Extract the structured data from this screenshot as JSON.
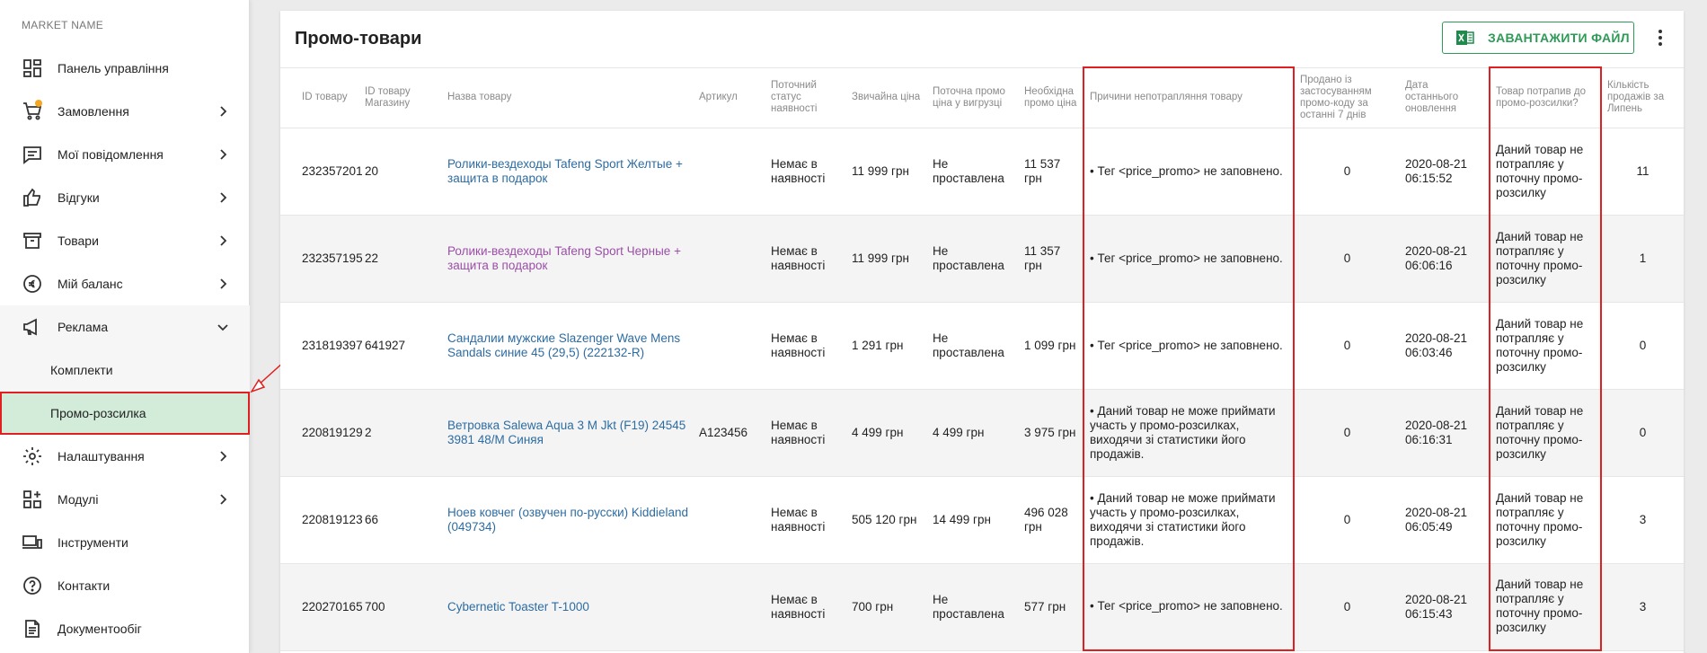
{
  "sidebar": {
    "market_name": "MARKET NAME",
    "items": [
      {
        "label": "Панель управління",
        "icon": "dashboard-icon",
        "has_children": false
      },
      {
        "label": "Замовлення",
        "icon": "cart-icon",
        "has_children": true,
        "badge": true
      },
      {
        "label": "Мої повідомлення",
        "icon": "message-icon",
        "has_children": true
      },
      {
        "label": "Відгуки",
        "icon": "thumb-up-icon",
        "has_children": true
      },
      {
        "label": "Товари",
        "icon": "box-icon",
        "has_children": true
      },
      {
        "label": "Мій баланс",
        "icon": "balance-icon",
        "has_children": true
      },
      {
        "label": "Реклама",
        "icon": "megaphone-icon",
        "has_children": true,
        "expanded": true,
        "children": [
          {
            "label": "Комплекти",
            "active": false
          },
          {
            "label": "Промо-розсилка",
            "active": true
          }
        ]
      },
      {
        "label": "Налаштування",
        "icon": "gear-icon",
        "has_children": true
      },
      {
        "label": "Модулі",
        "icon": "modules-icon",
        "has_children": true
      },
      {
        "label": "Інструменти",
        "icon": "devices-icon",
        "has_children": false
      },
      {
        "label": "Контакти",
        "icon": "help-icon",
        "has_children": false
      },
      {
        "label": "Документообіг",
        "icon": "document-icon",
        "has_children": false
      }
    ]
  },
  "main": {
    "title": "Промо-товари",
    "download_label": "ЗАВАНТАЖИТИ ФАЙЛ",
    "columns": [
      "ID товару",
      "ID товару Магазину",
      "Назва товару",
      "Артикул",
      "Поточний статус наявності",
      "Звичайна ціна",
      "Поточна промо ціна у вигрузці",
      "Необхідна промо ціна",
      "Причини непотрапляння товару",
      "Продано із застосуванням промо-коду за останні 7 днів",
      "Дата останнього оновлення",
      "Товар потрапив до промо-розсилки?",
      "Кількість продажів за Липень"
    ],
    "rows": [
      {
        "id": "232357201",
        "shop_id": "20",
        "name": "Ролики-вездеходы Tafeng Sport Желтые + защита в подарок",
        "visited": false,
        "sku": "",
        "status": "Немає в наявності",
        "price": "11 999 грн",
        "promo_price": "Не проставлена",
        "required_price": "11 537 грн",
        "reason": "• Тег <price_promo> не заповнено.",
        "sold": "0",
        "updated": "2020-08-21 06:15:52",
        "in_promo": "Даний товар не потрапляє у поточну промо-розсилку",
        "july_sales": "11"
      },
      {
        "id": "232357195",
        "shop_id": "22",
        "name": "Ролики-вездеходы Tafeng Sport Черные + защита в подарок",
        "visited": true,
        "sku": "",
        "status": "Немає в наявності",
        "price": "11 999 грн",
        "promo_price": "Не проставлена",
        "required_price": "11 357 грн",
        "reason": "• Тег <price_promo> не заповнено.",
        "sold": "0",
        "updated": "2020-08-21 06:06:16",
        "in_promo": "Даний товар не потрапляє у поточну промо-розсилку",
        "july_sales": "1"
      },
      {
        "id": "231819397",
        "shop_id": "641927",
        "name": "Сандалии мужские Slazenger Wave Mens Sandals синие 45 (29,5) (222132-R)",
        "visited": false,
        "sku": "",
        "status": "Немає в наявності",
        "price": "1 291 грн",
        "promo_price": "Не проставлена",
        "required_price": "1 099 грн",
        "reason": "• Тег <price_promo> не заповнено.",
        "sold": "0",
        "updated": "2020-08-21 06:03:46",
        "in_promo": "Даний товар не потрапляє у поточну промо-розсилку",
        "july_sales": "0"
      },
      {
        "id": "220819129",
        "shop_id": "2",
        "name": "Ветровка Salewa Aqua 3 M Jkt (F19) 24545 3981 48/M Синяя",
        "visited": false,
        "sku": "A123456",
        "status": "Немає в наявності",
        "price": "4 499 грн",
        "promo_price": "4 499 грн",
        "required_price": "3 975 грн",
        "reason": "• Даний товар не може приймати участь у промо-розсилках, виходячи зі статистики його продажів.",
        "sold": "0",
        "updated": "2020-08-21 06:16:31",
        "in_promo": "Даний товар не потрапляє у поточну промо-розсилку",
        "july_sales": "0"
      },
      {
        "id": "220819123",
        "shop_id": "66",
        "name": "Ноев ковчег (озвучен по-русски) Kiddieland (049734)",
        "visited": false,
        "sku": "",
        "status": "Немає в наявності",
        "price": "505 120 грн",
        "promo_price": "14 499 грн",
        "required_price": "496 028 грн",
        "reason": "• Даний товар не може приймати участь у промо-розсилках, виходячи зі статистики його продажів.",
        "sold": "0",
        "updated": "2020-08-21 06:05:49",
        "in_promo": "Даний товар не потрапляє у поточну промо-розсилку",
        "july_sales": "3"
      },
      {
        "id": "220270165",
        "shop_id": "700",
        "name": "Cybernetic Toaster T-1000",
        "visited": false,
        "sku": "",
        "status": "Немає в наявності",
        "price": "700 грн",
        "promo_price": "Не проставлена",
        "required_price": "577 грн",
        "reason": "• Тег <price_promo> не заповнено.",
        "sold": "0",
        "updated": "2020-08-21 06:15:43",
        "in_promo": "Даний товар не потрапляє у поточну промо-розсилку",
        "july_sales": "3"
      }
    ]
  },
  "colors": {
    "accent_green": "#2e9a56",
    "active_bg": "#d2ecd9",
    "highlight_red": "#e02020",
    "link_blue": "#2d6ca2",
    "link_visited": "#9b4fa7",
    "badge_orange": "#f5a623"
  }
}
